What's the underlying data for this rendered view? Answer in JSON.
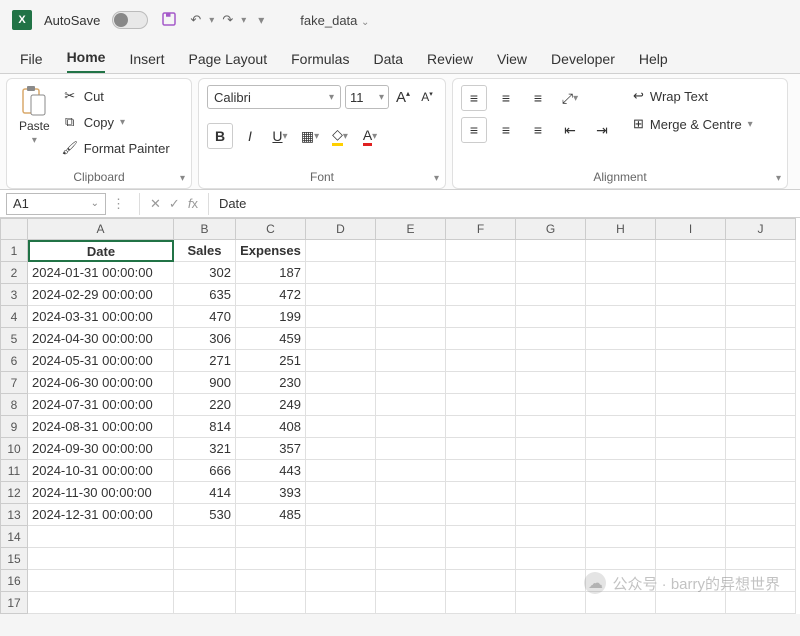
{
  "titlebar": {
    "autosave": "AutoSave",
    "filename": "fake_data"
  },
  "tabs": [
    "File",
    "Home",
    "Insert",
    "Page Layout",
    "Formulas",
    "Data",
    "Review",
    "View",
    "Developer",
    "Help"
  ],
  "active_tab": "Home",
  "clipboard": {
    "paste": "Paste",
    "cut": "Cut",
    "copy": "Copy",
    "format_painter": "Format Painter",
    "group": "Clipboard"
  },
  "font": {
    "name": "Calibri",
    "size": "11",
    "group": "Font"
  },
  "alignment": {
    "wrap": "Wrap Text",
    "merge": "Merge & Centre",
    "group": "Alignment"
  },
  "namebox": "A1",
  "formula_value": "Date",
  "columns": [
    "A",
    "B",
    "C",
    "D",
    "E",
    "F",
    "G",
    "H",
    "I",
    "J"
  ],
  "headers": [
    "Date",
    "Sales",
    "Expenses"
  ],
  "data_rows": [
    {
      "date": "2024-01-31 00:00:00",
      "sales": 302,
      "expenses": 187
    },
    {
      "date": "2024-02-29 00:00:00",
      "sales": 635,
      "expenses": 472
    },
    {
      "date": "2024-03-31 00:00:00",
      "sales": 470,
      "expenses": 199
    },
    {
      "date": "2024-04-30 00:00:00",
      "sales": 306,
      "expenses": 459
    },
    {
      "date": "2024-05-31 00:00:00",
      "sales": 271,
      "expenses": 251
    },
    {
      "date": "2024-06-30 00:00:00",
      "sales": 900,
      "expenses": 230
    },
    {
      "date": "2024-07-31 00:00:00",
      "sales": 220,
      "expenses": 249
    },
    {
      "date": "2024-08-31 00:00:00",
      "sales": 814,
      "expenses": 408
    },
    {
      "date": "2024-09-30 00:00:00",
      "sales": 321,
      "expenses": 357
    },
    {
      "date": "2024-10-31 00:00:00",
      "sales": 666,
      "expenses": 443
    },
    {
      "date": "2024-11-30 00:00:00",
      "sales": 414,
      "expenses": 393
    },
    {
      "date": "2024-12-31 00:00:00",
      "sales": 530,
      "expenses": 485
    }
  ],
  "empty_rows": [
    14,
    15,
    16,
    17
  ],
  "watermark": "公众号 · barry的异想世界"
}
